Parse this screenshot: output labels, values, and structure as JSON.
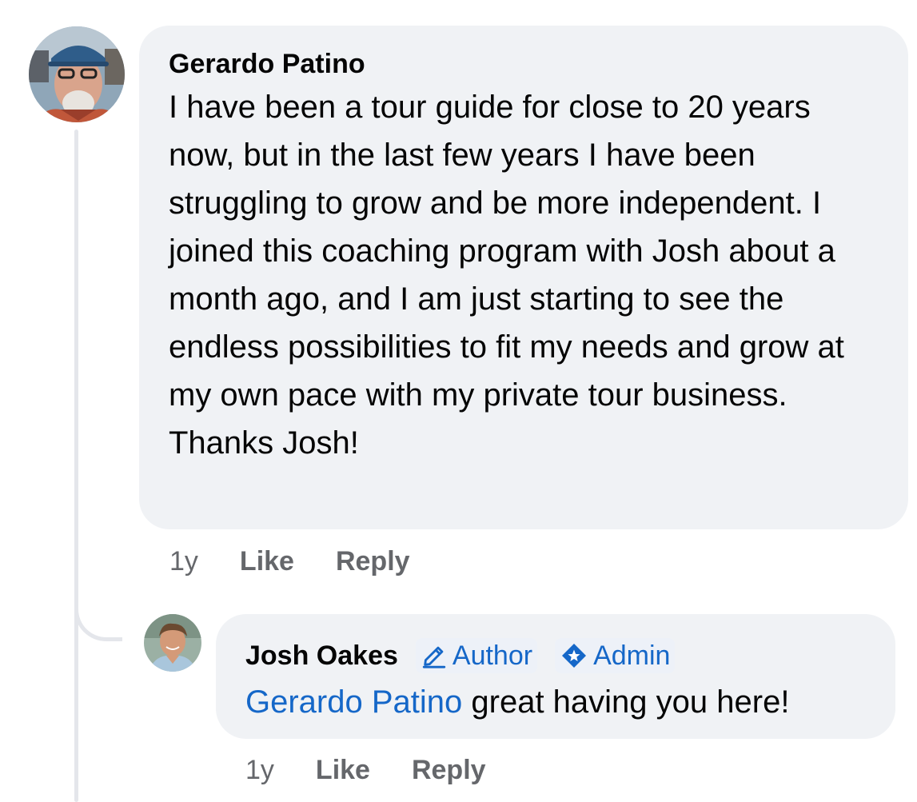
{
  "comment": {
    "author": "Gerardo Patino",
    "text": "I have been a tour guide for close to 20 years now, but in the last few years I have been struggling to grow and be more independent. I joined this coaching program with Josh about a month ago, and I am just starting to see the endless possibilities to fit my needs and grow at my own pace with my private tour business. Thanks Josh!",
    "time": "1y",
    "like_label": "Like",
    "reply_label": "Reply"
  },
  "reply": {
    "author": "Josh Oakes",
    "badges": {
      "author": "Author",
      "admin": "Admin"
    },
    "mention": "Gerardo Patino",
    "text": " great having you here!",
    "time": "1y",
    "like_label": "Like",
    "reply_label": "Reply"
  },
  "colors": {
    "bubble": "#f0f2f5",
    "link": "#1567c8",
    "meta": "#65676b",
    "thread_line": "#e4e6eb"
  },
  "icons": {
    "author_badge": "pencil-icon",
    "admin_badge": "admin-shield-icon"
  }
}
